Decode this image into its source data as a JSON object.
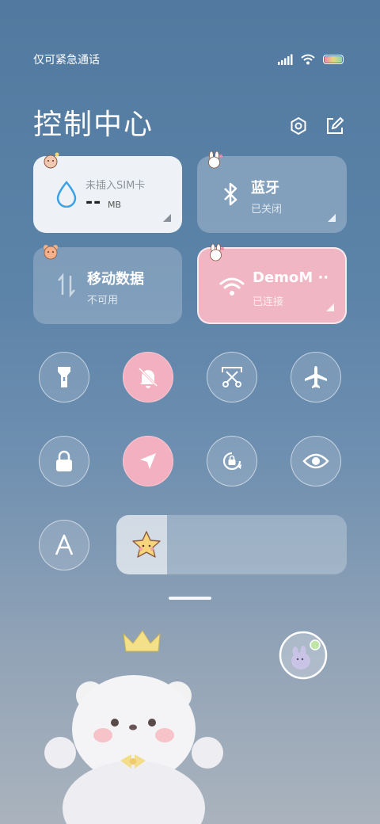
{
  "status_bar": {
    "carrier": "仅可紧急通话",
    "icons": [
      "signal-icon",
      "wifi-icon",
      "battery-icon"
    ],
    "battery_colors": [
      "#f08aa8",
      "#e6d77a",
      "#8fd7a0"
    ]
  },
  "header": {
    "title": "控制中心",
    "icons": [
      "settings-icon",
      "edit-icon"
    ]
  },
  "tiles": {
    "data_usage": {
      "label": "未插入SIM卡",
      "value": "--",
      "unit": "MB",
      "icon": "water-drop-icon",
      "accent": "#3aa2e6"
    },
    "bluetooth": {
      "label": "蓝牙",
      "status": "已关闭",
      "icon": "bluetooth-icon"
    },
    "mobile_data": {
      "label": "移动数据",
      "status": "不可用",
      "icon": "data-arrows-icon"
    },
    "wifi": {
      "label": "DemoM ··",
      "status": "已连接",
      "icon": "wifi-icon",
      "accent": "#f1b6c4"
    }
  },
  "toggles": [
    {
      "name": "flashlight",
      "icon": "flashlight-icon",
      "active": false
    },
    {
      "name": "mute",
      "icon": "bell-off-icon",
      "active": true
    },
    {
      "name": "screenshot",
      "icon": "scissors-icon",
      "active": false
    },
    {
      "name": "airplane",
      "icon": "airplane-icon",
      "active": false
    },
    {
      "name": "lock",
      "icon": "lock-icon",
      "active": false
    },
    {
      "name": "location",
      "icon": "location-arrow-icon",
      "active": true
    },
    {
      "name": "auto-rotate",
      "icon": "rotate-lock-icon",
      "active": false
    },
    {
      "name": "eye-comfort",
      "icon": "eye-icon",
      "active": false
    },
    {
      "name": "font",
      "icon": "letter-a-icon",
      "active": false
    }
  ],
  "brightness": {
    "level": 0.22,
    "thumb_icon": "star-sticker-icon"
  },
  "colors": {
    "active_pink": "#f3b0c0",
    "background": "#527aa0"
  }
}
